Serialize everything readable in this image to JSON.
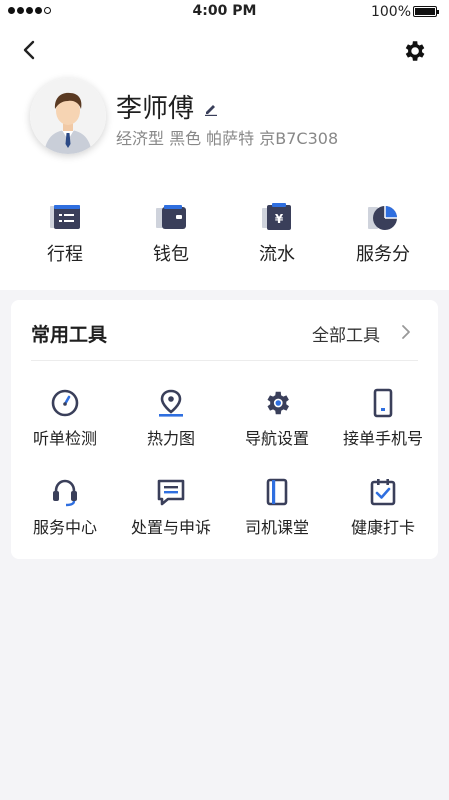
{
  "status": {
    "time": "4:00 PM",
    "battery": "100%"
  },
  "profile": {
    "name": "李师傅",
    "car_info": "经济型 黑色 帕萨特 京B7C308"
  },
  "quick_links": [
    {
      "label": "行程",
      "icon": "itinerary-icon"
    },
    {
      "label": "钱包",
      "icon": "wallet-icon"
    },
    {
      "label": "流水",
      "icon": "transactions-icon"
    },
    {
      "label": "服务分",
      "icon": "service-score-icon"
    }
  ],
  "tools_card": {
    "title": "常用工具",
    "all_label": "全部工具",
    "items": [
      {
        "label": "听单检测",
        "icon": "gauge-icon"
      },
      {
        "label": "热力图",
        "icon": "location-pin-icon"
      },
      {
        "label": "导航设置",
        "icon": "gear-icon"
      },
      {
        "label": "接单手机号",
        "icon": "phone-icon"
      },
      {
        "label": "服务中心",
        "icon": "headset-icon"
      },
      {
        "label": "处置与申诉",
        "icon": "message-icon"
      },
      {
        "label": "司机课堂",
        "icon": "book-icon"
      },
      {
        "label": "健康打卡",
        "icon": "calendar-check-icon"
      }
    ]
  },
  "colors": {
    "icon_dark": "#3a3f5a",
    "accent": "#2f6fe0",
    "background": "#f4f4f7"
  }
}
